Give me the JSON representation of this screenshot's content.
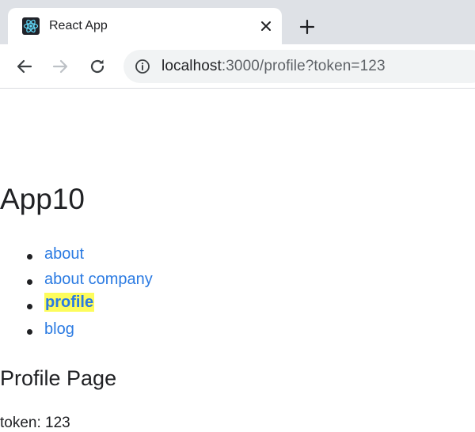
{
  "browser": {
    "tab": {
      "title": "React App",
      "favicon": "react-logo-icon"
    },
    "url": {
      "host": "localhost",
      "rest": ":3000/profile?token=123"
    },
    "icons": {
      "close": "close-icon",
      "new_tab": "plus-icon",
      "back": "arrow-left-icon",
      "forward": "arrow-right-icon",
      "reload": "reload-icon",
      "info": "info-icon"
    }
  },
  "page": {
    "app_title": "App10",
    "nav": [
      {
        "label": "about",
        "active": false
      },
      {
        "label": "about company",
        "active": false
      },
      {
        "label": "profile",
        "active": true
      },
      {
        "label": "blog",
        "active": false
      }
    ],
    "heading": "Profile Page",
    "token_line": "token: 123"
  },
  "colors": {
    "link": "#2a7ae2",
    "active_highlight": "#fdfc5c",
    "tabstrip": "#dee1e6",
    "omnibox": "#f1f3f4",
    "react_logo": "#61dafb"
  }
}
